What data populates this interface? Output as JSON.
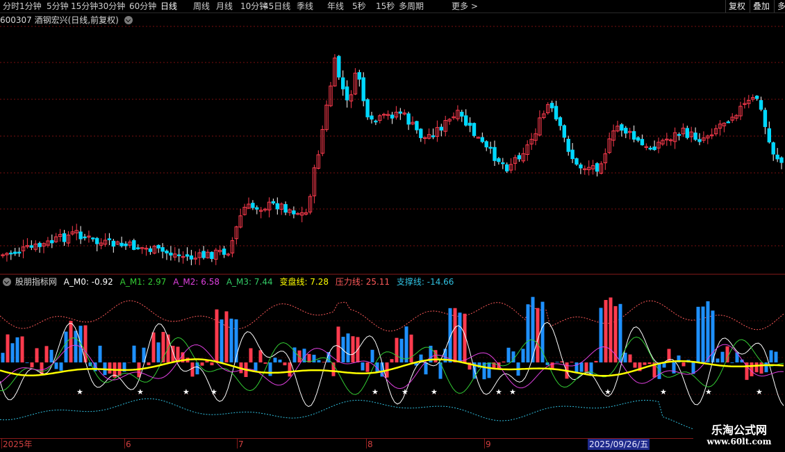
{
  "toolbar": {
    "periods": [
      "分时",
      "1分钟",
      "5分钟",
      "15分钟",
      "30分钟",
      "60分钟",
      "日线",
      "周线",
      "月线",
      "10分钟",
      "45日线",
      "季线",
      "年线",
      "5秒",
      "15秒",
      "多周期",
      "更多 >"
    ],
    "active": "日线",
    "right_buttons": [
      "复权",
      "叠加",
      "多"
    ]
  },
  "stock_title": "600307 酒钢宏兴(日线,前复权)",
  "indicator": {
    "name": "股朋指标网",
    "m0": "A_M0: -0.92",
    "m1": "A_M1: 2.97",
    "m2": "A_M2: 6.58",
    "m3": "A_M3: 7.44",
    "turn": "变盘线: 7.28",
    "pressure": "压力线: 25.11",
    "support": "支撑线: -14.66"
  },
  "colors": {
    "up": "#ff3b4e",
    "down": "#00d8ff",
    "m1": "#33cc33",
    "m2": "#e040e0",
    "m3": "#ffff00",
    "pressure": "#ff5a5a",
    "support": "#30c0e0",
    "grid": "#7a1010"
  },
  "date_axis": {
    "labels": [
      "2025年",
      "6",
      "7",
      "8",
      "9"
    ],
    "highlight": "2025/09/26/五"
  },
  "watermark": {
    "title": "乐淘公式网",
    "url": "www.60lt.com"
  }
}
